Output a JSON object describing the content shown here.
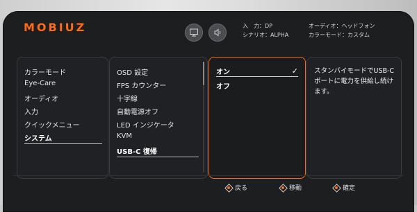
{
  "brand": {
    "logo": "MOBIUZ",
    "accent": "#ff6a1a"
  },
  "header": {
    "input_label": "入　力",
    "input_value": "DP",
    "scenario_label": "シナリオ",
    "scenario_value": "ALPHA",
    "audio_label": "オーディオ",
    "audio_value": "ヘッドフォン",
    "color_label": "カラーモード",
    "color_value": "カスタム"
  },
  "main_menu": {
    "items": [
      "カラーモード",
      "Eye-Care",
      "オーディオ",
      "入力",
      "クイックメニュー",
      "システム"
    ],
    "selected": "システム"
  },
  "sub_menu": {
    "items": [
      "OSD 設定",
      "FPS カウンター",
      "十字線",
      "自動電源オフ",
      "LED インジケータ",
      "KVM",
      "USB-C 復帰"
    ],
    "selected": "USB-C 復帰"
  },
  "options": {
    "items": [
      "オン",
      "オフ"
    ],
    "selected": "オン",
    "check_icon": "check-icon"
  },
  "description": {
    "text": "スタンバイモードでUSB-Cポートに電力を供給し続けます。"
  },
  "footer": {
    "back": "戻る",
    "move": "移動",
    "confirm": "確定"
  },
  "icons": [
    "picture-mode-icon",
    "audio-mode-icon"
  ]
}
